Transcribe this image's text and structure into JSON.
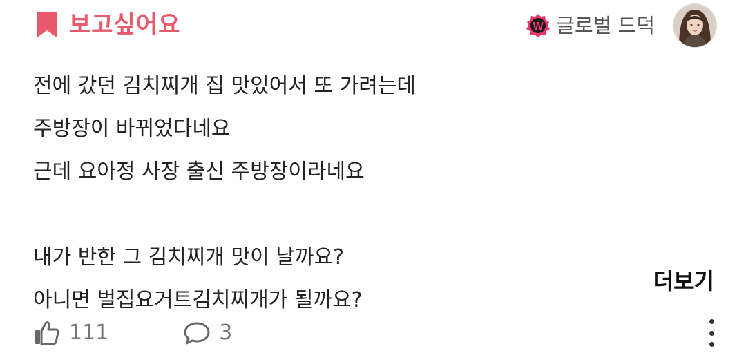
{
  "post": {
    "category": "보고싶어요",
    "author": {
      "nickname": "글로벌 드덕",
      "badge_letter": "W"
    },
    "lines": [
      "전에 갔던 김치찌개 집 맛있어서 또 가려는데",
      "주방장이 바뀌었다네요",
      "근데 요아정 사장 출신 주방장이라네요",
      "",
      "내가 반한 그 김치찌개 맛이 날까요?",
      "아니면 벌집요거트김치찌개가 될까요?"
    ],
    "more_label": "더보기",
    "likes": "111",
    "comments": "3"
  },
  "icons": {
    "category": "bookmark-icon",
    "badge": "w-badge-icon",
    "like": "thumbs-up-icon",
    "comment": "speech-bubble-icon",
    "menu": "more-vertical-icon"
  },
  "colors": {
    "accent": "#e8596b",
    "badge": "#e8386b",
    "text": "#222222",
    "muted": "#777777"
  }
}
